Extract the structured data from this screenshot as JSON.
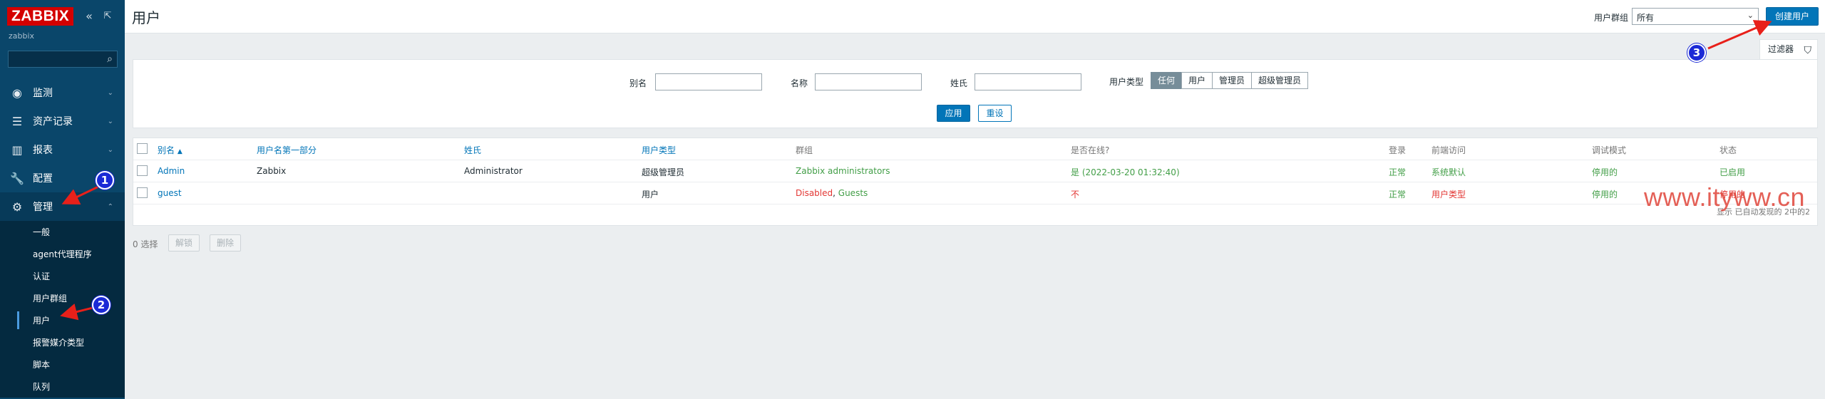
{
  "sidebar": {
    "logo": "ZABBIX",
    "collapse_icon": "double-chevron-left-icon",
    "kiosk_icon": "expand-icon",
    "server_name": "zabbix",
    "search_placeholder": "",
    "menu": [
      {
        "label": "监测",
        "icon": "eye-icon"
      },
      {
        "label": "资产记录",
        "icon": "list-icon"
      },
      {
        "label": "报表",
        "icon": "chart-icon"
      },
      {
        "label": "配置",
        "icon": "wrench-icon"
      },
      {
        "label": "管理",
        "icon": "gear-icon"
      }
    ],
    "submenu": [
      {
        "label": "一般"
      },
      {
        "label": "agent代理程序"
      },
      {
        "label": "认证"
      },
      {
        "label": "用户群组"
      },
      {
        "label": "用户"
      },
      {
        "label": "报警媒介类型"
      },
      {
        "label": "脚本"
      },
      {
        "label": "队列"
      }
    ]
  },
  "header": {
    "title": "用户",
    "group_label": "用户群组",
    "group_value": "所有",
    "create_button": "创建用户"
  },
  "filter": {
    "tab_label": "过滤器",
    "alias_label": "别名",
    "name_label": "名称",
    "surname_label": "姓氏",
    "type_label": "用户类型",
    "type_options": [
      "任何",
      "用户",
      "管理员",
      "超级管理员"
    ],
    "type_selected": "任何",
    "apply": "应用",
    "reset": "重设"
  },
  "table": {
    "headers": [
      "别名",
      "用户名第一部分",
      "姓氏",
      "用户类型",
      "群组",
      "是否在线?",
      "登录",
      "前端访问",
      "调试模式",
      "状态"
    ],
    "sort_indicator": "▲",
    "rows": [
      {
        "alias": "Admin",
        "name": "Zabbix",
        "surname": "Administrator",
        "type": "超级管理员",
        "groups": "Zabbix administrators",
        "online": "是 (2022-03-20 01:32:40)",
        "login": "正常",
        "frontend": "系统默认",
        "debug": "停用的",
        "status": "已启用"
      },
      {
        "alias": "guest",
        "name": "",
        "surname": "",
        "type": "用户",
        "group_disabled": "Disabled",
        "group_sep": ", ",
        "group_guests": "Guests",
        "online": "不",
        "login": "正常",
        "frontend": "用户类型",
        "debug": "停用的",
        "status": "停用的"
      }
    ],
    "footer": "显示 已自动发现的 2中的2"
  },
  "actions": {
    "selected": "0 选择",
    "unblock": "解锁",
    "delete": "删除"
  },
  "watermark": "www.ityww.cn",
  "annotations": [
    "1",
    "2",
    "3"
  ]
}
